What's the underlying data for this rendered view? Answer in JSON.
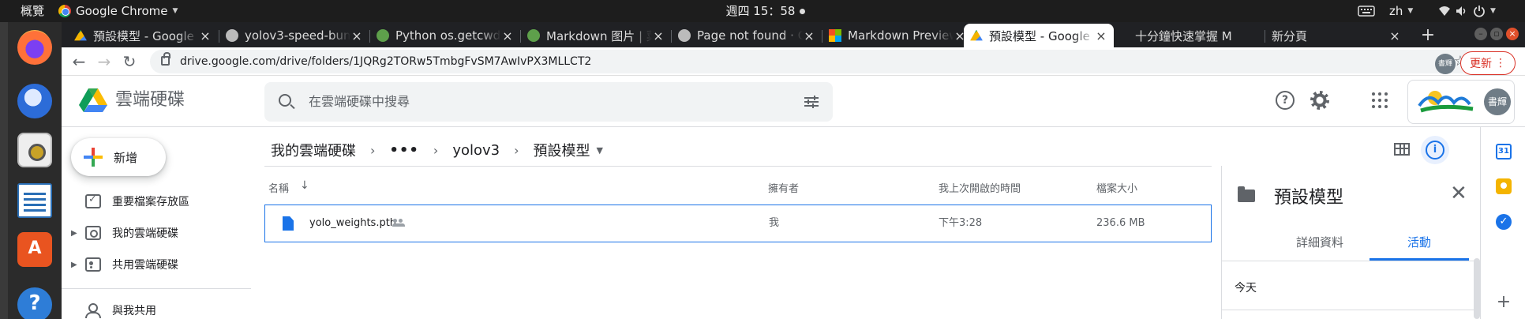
{
  "ubuntu_topbar": {
    "activities": "概覽",
    "app_name": "Google Chrome",
    "clock": "週四 15：58",
    "input_method": "zh"
  },
  "chrome": {
    "tabs": [
      {
        "title": "預設模型 - Google",
        "favicon": "drive-icon",
        "color": "#1a73e8"
      },
      {
        "title": "yolov3-speed-bump",
        "favicon": "github-icon",
        "color": "#24292e"
      },
      {
        "title": "Python os.getcwd",
        "favicon": "runoob-icon",
        "color": "#5ea04b"
      },
      {
        "title": "Markdown 图片 | 菜",
        "favicon": "runoob-icon",
        "color": "#5ea04b"
      },
      {
        "title": "Page not found · G",
        "favicon": "github-icon",
        "color": "#24292e"
      },
      {
        "title": "Markdown Preview",
        "favicon": "microsoft-icon",
        "color": "#f25022"
      },
      {
        "title": "預設模型 - Google",
        "favicon": "drive-icon",
        "color": "#1a73e8"
      },
      {
        "title": "十分鐘快速掌握 M",
        "favicon": "none",
        "color": ""
      },
      {
        "title": "新分頁",
        "favicon": "none",
        "color": ""
      }
    ],
    "active_tab_index": 6,
    "url": "drive.google.com/drive/folders/1JQRg2TORw5TmbgFvSM7AwIvPX3MLLCT2",
    "profile_label": "書輝",
    "update_label": "更新"
  },
  "drive": {
    "product_title": "雲端硬碟",
    "search_placeholder": "在雲端硬碟中搜尋",
    "avatar_label": "書輝",
    "new_button": "新增",
    "sidebar": [
      {
        "label": "重要檔案存放區",
        "icon": "priority-icon",
        "expandable": false
      },
      {
        "label": "我的雲端硬碟",
        "icon": "my-drive-icon",
        "expandable": true
      },
      {
        "label": "共用雲端硬碟",
        "icon": "shared-drives-icon",
        "expandable": true
      },
      {
        "label": "與我共用",
        "icon": "shared-with-me-icon",
        "expandable": false
      }
    ],
    "breadcrumb": {
      "root": "我的雲端硬碟",
      "more": "•••",
      "parent": "yolov3",
      "current": "預設模型"
    },
    "columns": {
      "name": "名稱",
      "owner": "擁有者",
      "last_opened": "我上次開啟的時間",
      "size": "檔案大小"
    },
    "files": [
      {
        "name": "yolo_weights.pth",
        "owner": "我",
        "last_opened": "下午3:28",
        "size": "236.6 MB"
      }
    ],
    "details": {
      "title": "預設模型",
      "tabs": [
        "詳細資料",
        "活動"
      ],
      "active_tab": "活動",
      "section": "今天"
    },
    "calendar_day": "31"
  }
}
